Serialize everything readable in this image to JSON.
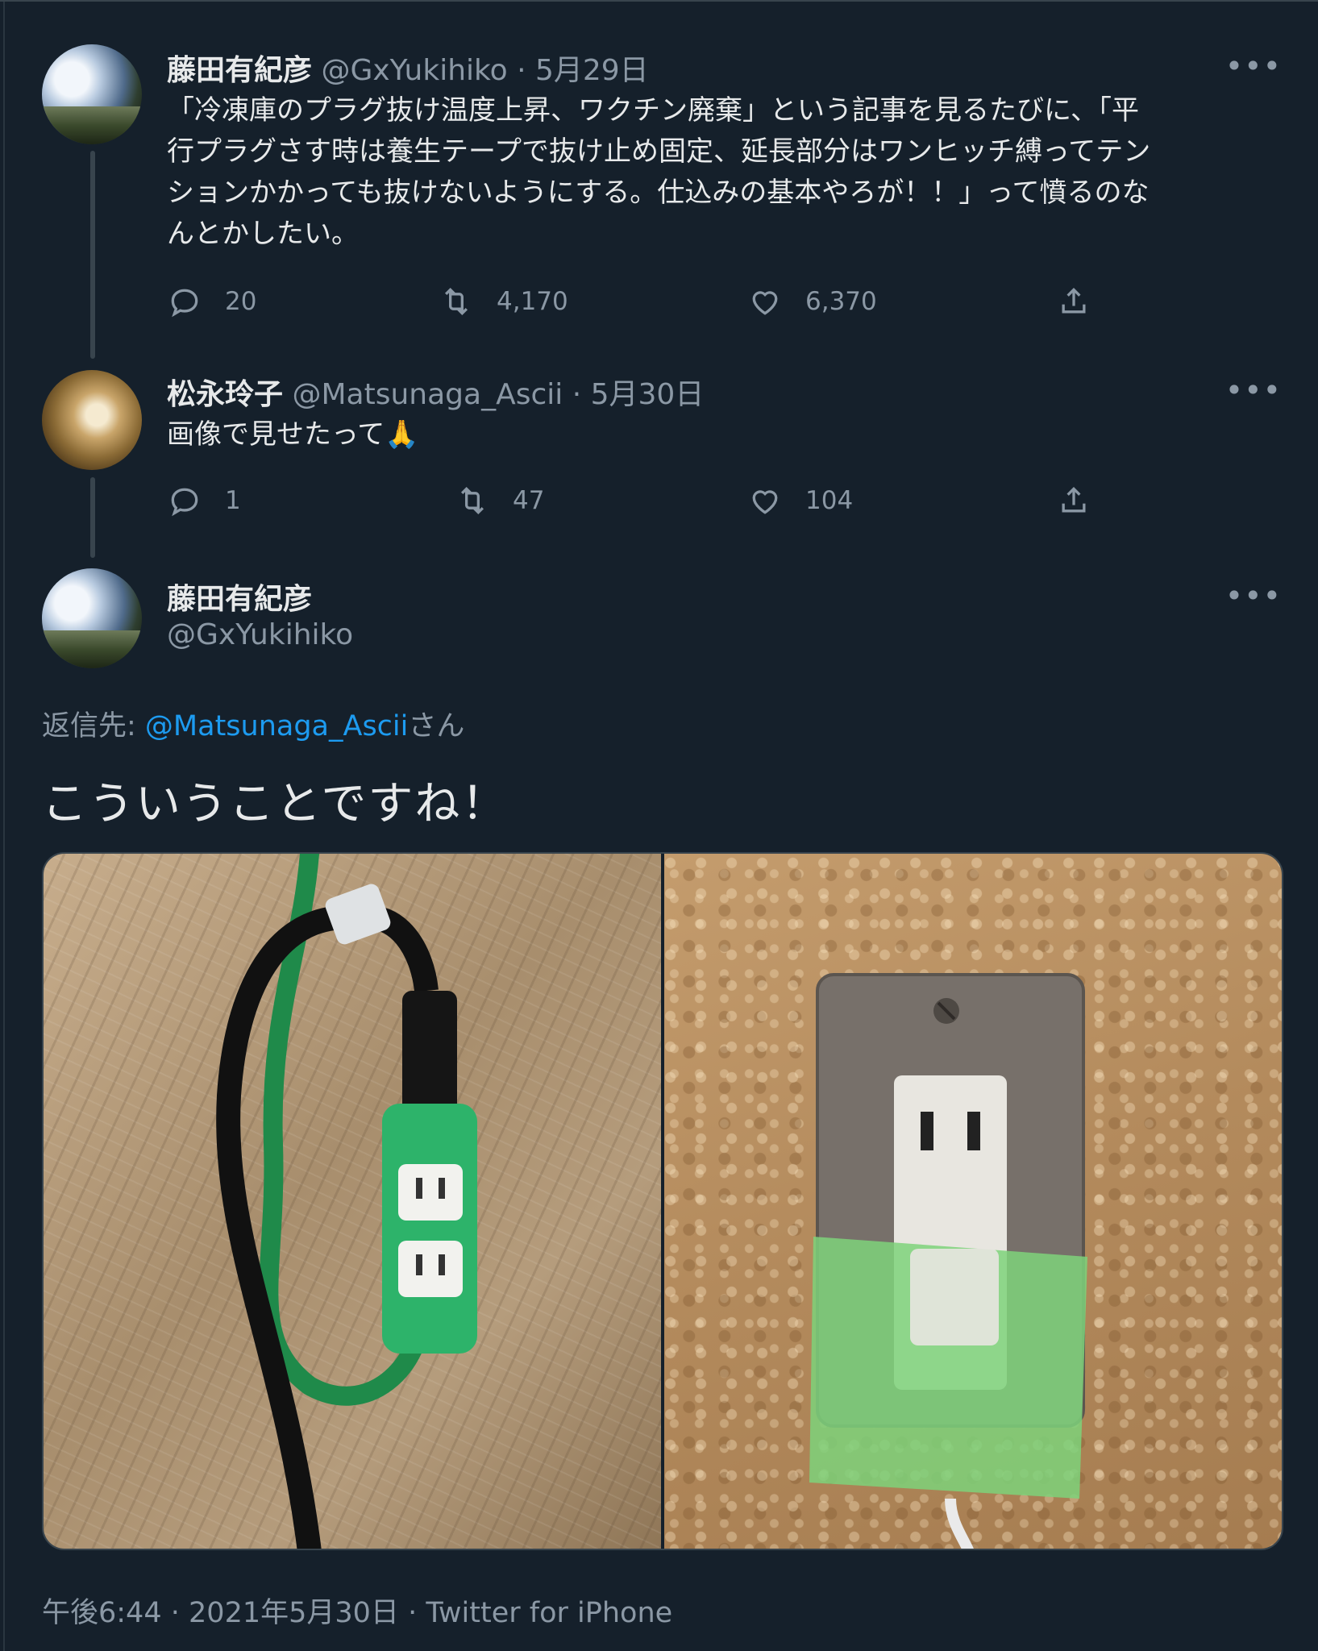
{
  "thread": [
    {
      "name": "藤田有紀彦",
      "handle": "@GxYukihiko",
      "separator": "·",
      "date": "5月29日",
      "more": "•••",
      "text": "「冷凍庫のプラグ抜け温度上昇、ワクチン廃棄」という記事を見るたびに、「平\n行プラグさす時は養生テープで抜け止め固定、延長部分はワンヒッチ縛ってテン\nションかかっても抜けないようにする。仕込みの基本やろが！！」って憤るのな\nんとかしたい。",
      "replies": "20",
      "retweets": "4,170",
      "likes": "6,370"
    },
    {
      "name": "松永玲子",
      "handle": "@Matsunaga_Ascii",
      "separator": "·",
      "date": "5月30日",
      "more": "•••",
      "text": "画像で見せたって🙏",
      "replies": "1",
      "retweets": "47",
      "likes": "104"
    }
  ],
  "main_tweet": {
    "name": "藤田有紀彦",
    "handle": "@GxYukihiko",
    "more": "•••",
    "reply_label": "返信先: ",
    "reply_mention": "@Matsunaga_Ascii",
    "reply_suffix": "さん",
    "text": "こういうことですね！",
    "time": "午後6:44",
    "separator": "·",
    "date": "2021年5月30日",
    "source": "Twitter for iPhone"
  },
  "colors": {
    "background": "#15202b",
    "text": "#e7e9ea",
    "secondary": "#8b98a5",
    "link": "#1d9bf0",
    "border": "#38444d"
  },
  "icons": [
    "reply-icon",
    "retweet-icon",
    "like-icon",
    "share-icon",
    "more-icon"
  ]
}
